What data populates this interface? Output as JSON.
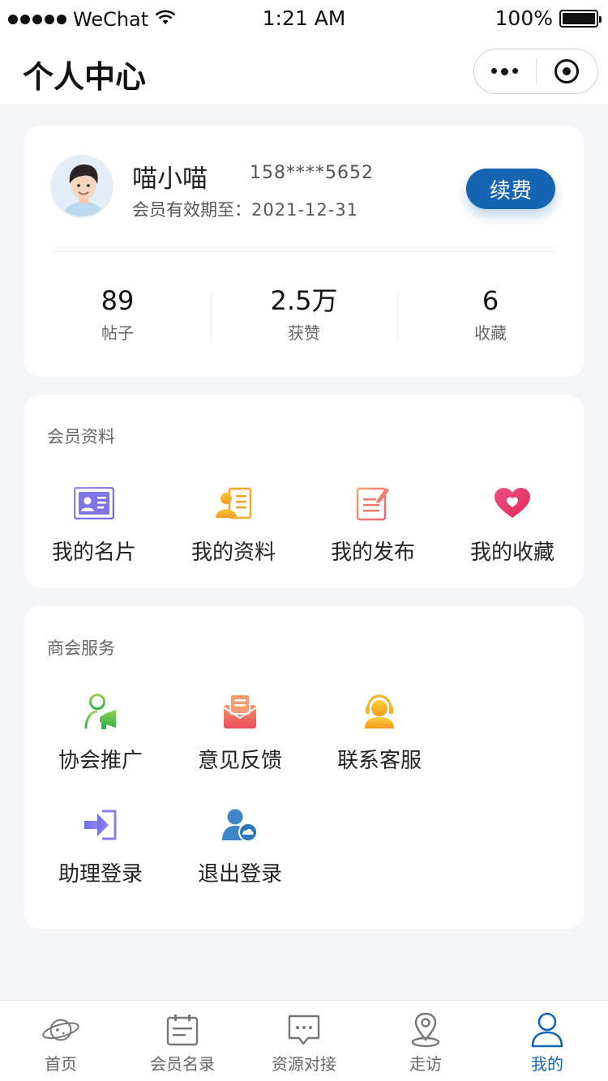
{
  "status_bar": {
    "carrier": "WeChat",
    "time": "1:21 AM",
    "battery": "100%"
  },
  "nav": {
    "title": "个人中心"
  },
  "profile": {
    "name": "喵小喵",
    "phone": "158****5652",
    "expiry_label": "会员有效期至：",
    "expiry_date": "2021-12-31",
    "renew_label": "续费",
    "stats": [
      {
        "value": "89",
        "label": "帖子"
      },
      {
        "value": "2.5万",
        "label": "获赞"
      },
      {
        "value": "6",
        "label": "收藏"
      }
    ]
  },
  "member_section": {
    "title": "会员资料",
    "items": [
      {
        "label": "我的名片",
        "icon": "id-card-icon"
      },
      {
        "label": "我的资料",
        "icon": "profile-doc-icon"
      },
      {
        "label": "我的发布",
        "icon": "edit-note-icon"
      },
      {
        "label": "我的收藏",
        "icon": "heart-icon"
      }
    ]
  },
  "service_section": {
    "title": "商会服务",
    "items": [
      {
        "label": "协会推广",
        "icon": "promote-icon"
      },
      {
        "label": "意见反馈",
        "icon": "feedback-mail-icon"
      },
      {
        "label": "联系客服",
        "icon": "customer-service-icon"
      },
      {
        "label": "助理登录",
        "icon": "login-arrow-icon"
      },
      {
        "label": "退出登录",
        "icon": "logout-user-icon"
      }
    ]
  },
  "tab_bar": {
    "tabs": [
      {
        "label": "首页",
        "icon": "planet-icon",
        "active": false
      },
      {
        "label": "会员名录",
        "icon": "calendar-list-icon",
        "active": false
      },
      {
        "label": "资源对接",
        "icon": "chat-bubble-icon",
        "active": false
      },
      {
        "label": "走访",
        "icon": "location-pin-icon",
        "active": false
      },
      {
        "label": "我的",
        "icon": "user-icon",
        "active": true
      }
    ]
  },
  "colors": {
    "accent": "#1565b3",
    "background": "#f4f5f7",
    "card": "#ffffff"
  }
}
